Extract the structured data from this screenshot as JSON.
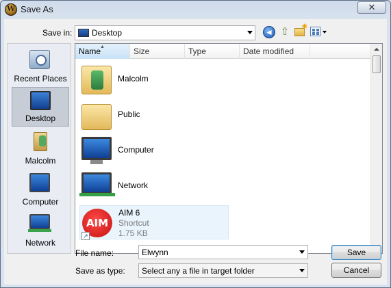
{
  "window": {
    "title": "Save As",
    "app_icon": "W",
    "close_symbol": "✕"
  },
  "toolbar": {
    "save_in_label": "Save in:",
    "save_in_value": "Desktop",
    "icons": [
      "back-arrow-icon",
      "up-folder-icon",
      "new-folder-icon",
      "views-menu-icon"
    ]
  },
  "places": [
    {
      "label": "Recent Places",
      "icon": "recent-places-icon"
    },
    {
      "label": "Desktop",
      "icon": "desktop-icon",
      "selected": true
    },
    {
      "label": "Malcolm",
      "icon": "user-folder-icon"
    },
    {
      "label": "Computer",
      "icon": "computer-icon"
    },
    {
      "label": "Network",
      "icon": "network-icon"
    }
  ],
  "file_list": {
    "columns": [
      "Name",
      "Size",
      "Type",
      "Date modified"
    ],
    "sorted_by": "Name",
    "items": [
      {
        "name": "Malcolm",
        "icon": "user-folder-icon"
      },
      {
        "name": "Public",
        "icon": "folder-icon"
      },
      {
        "name": "Computer",
        "icon": "computer-icon"
      },
      {
        "name": "Network",
        "icon": "network-icon"
      },
      {
        "name": "AIM 6",
        "type": "Shortcut",
        "size": "1.75 KB",
        "icon": "aim-icon",
        "icon_text": "AIM",
        "shortcut_symbol": "↗"
      }
    ]
  },
  "form": {
    "file_name_label": "File name:",
    "file_name_value": "Elwynn",
    "save_as_type_label": "Save as type:",
    "save_as_type_value": "Select any a file in target folder"
  },
  "buttons": {
    "save": "Save",
    "cancel": "Cancel"
  },
  "colors": {
    "selection_bg": "#c7cdd6",
    "window_frame": "#d9e3ef",
    "aim_red": "#d81616"
  }
}
